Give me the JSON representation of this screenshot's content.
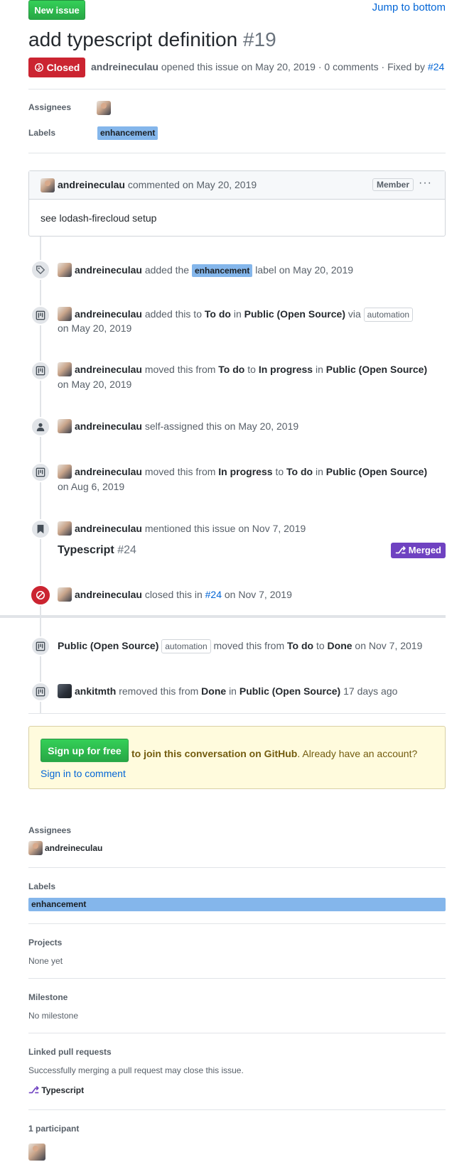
{
  "header": {
    "new_issue": "New issue",
    "jump": "Jump to bottom",
    "title": "add typescript definition",
    "number": "#19",
    "state": "Closed",
    "author": "andreineculau",
    "meta_rest": "opened this issue on May 20, 2019 · 0 comments · Fixed by",
    "fixed_by": "#24"
  },
  "top_sidebar": {
    "assignees_label": "Assignees",
    "labels_label": "Labels",
    "label": "enhancement"
  },
  "comment": {
    "author": "andreineculau",
    "action": "commented",
    "date": "on May 20, 2019",
    "badge": "Member",
    "menu": "···",
    "body": "see lodash-firecloud setup"
  },
  "timeline": [
    {
      "user": "andreineculau",
      "text1": "added the",
      "label": "enhancement",
      "text2": "label on May 20, 2019"
    },
    {
      "user": "andreineculau",
      "text1": "added this to",
      "b1": "To do",
      "text2": "in",
      "b2": "Public (Open Source)",
      "text3": "via",
      "tag": "automation",
      "line2": "on May 20, 2019"
    },
    {
      "user": "andreineculau",
      "text1": "moved this from",
      "b1": "To do",
      "text2": "to",
      "b2": "In progress",
      "text3": "in",
      "b3": "Public (Open Source)",
      "line2": "on May 20, 2019"
    },
    {
      "user": "andreineculau",
      "text1": "self-assigned this on May 20, 2019"
    },
    {
      "user": "andreineculau",
      "text1": "moved this from",
      "b1": "In progress",
      "text2": "to",
      "b2": "To do",
      "text3": "in",
      "b3": "Public (Open Source)",
      "line2": "on Aug 6, 2019"
    },
    {
      "user": "andreineculau",
      "text1": "mentioned this issue on Nov 7, 2019",
      "ref_title": "Typescript",
      "ref_num": "#24",
      "ref_state": "Merged"
    },
    {
      "user": "andreineculau",
      "text1": "closed this in",
      "link": "#24",
      "text2": "on Nov 7, 2019"
    },
    {
      "b0": "Public (Open Source)",
      "tag": "automation",
      "text1": "moved this from",
      "b1": "To do",
      "text2": "to",
      "b2": "Done",
      "text3": "on Nov 7, 2019"
    },
    {
      "user": "ankitmth",
      "text1": "removed this from",
      "b1": "Done",
      "text2": "in",
      "b2": "Public (Open Source)",
      "text3": "17 days ago"
    }
  ],
  "signup": {
    "button": "Sign up for free",
    "strong": "to join this conversation on GitHub",
    "rest": ". Already have an account?",
    "link": "Sign in to comment"
  },
  "sidebar": {
    "assignees_label": "Assignees",
    "assignee": "andreineculau",
    "labels_label": "Labels",
    "label": "enhancement",
    "projects_label": "Projects",
    "projects_value": "None yet",
    "milestone_label": "Milestone",
    "milestone_value": "No milestone",
    "linked_label": "Linked pull requests",
    "linked_desc": "Successfully merging a pull request may close this issue.",
    "linked_pr": "Typescript",
    "participants_label": "1 participant"
  },
  "colors": {
    "green": "#28a745",
    "red": "#cb2431",
    "purple": "#6f42c1",
    "label": "#84b6eb",
    "link": "#0366d6"
  }
}
